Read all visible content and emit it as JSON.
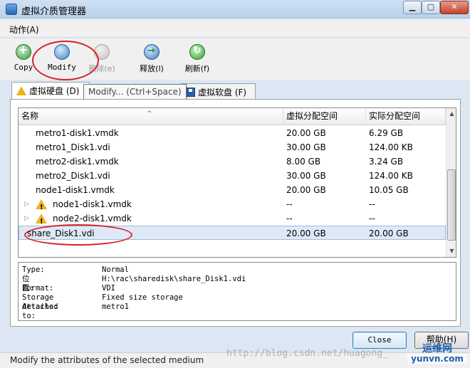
{
  "window": {
    "title": "虚拟介质管理器",
    "buttons": {
      "minimize": "▁",
      "maximize": "▢",
      "close": "✕"
    }
  },
  "menu": {
    "items": [
      {
        "label": "动作(A)"
      }
    ]
  },
  "toolbar": {
    "buttons": [
      {
        "label": "Copy",
        "icon": "copy-icon",
        "enabled": true
      },
      {
        "label": "Modify",
        "icon": "modify-icon",
        "enabled": true
      },
      {
        "label": "删除(e)",
        "icon": "delete-icon",
        "enabled": false
      },
      {
        "label": "释放(l)",
        "icon": "release-icon",
        "enabled": true
      },
      {
        "label": "刷新(f)",
        "icon": "refresh-icon",
        "enabled": true
      }
    ]
  },
  "tooltip": {
    "text": "Modify... (Ctrl+Space)"
  },
  "tabs": [
    {
      "label": "虚拟硬盘 (D)",
      "icon": "warning-icon",
      "active": true
    },
    {
      "label": "虚拟软盘 (F)",
      "icon": "floppy-icon",
      "active": false
    }
  ],
  "table": {
    "columns": {
      "name": "名称",
      "virtual_size": "虚拟分配空间",
      "actual_size": "实际分配空间"
    },
    "rows": [
      {
        "name": "metro1-disk1.vmdk",
        "virtual_size": "20.00 GB",
        "actual_size": "6.29 GB"
      },
      {
        "name": "metro1_Disk1.vdi",
        "virtual_size": "30.00 GB",
        "actual_size": "124.00 KB"
      },
      {
        "name": "metro2-disk1.vmdk",
        "virtual_size": "8.00 GB",
        "actual_size": "3.24 GB"
      },
      {
        "name": "metro2_Disk1.vdi",
        "virtual_size": "30.00 GB",
        "actual_size": "124.00 KB"
      },
      {
        "name": "node1-disk1.vmdk",
        "virtual_size": "20.00 GB",
        "actual_size": "10.05 GB"
      },
      {
        "name": "node1-disk1.vmdk",
        "virtual_size": "--",
        "actual_size": "--",
        "warning": true,
        "expandable": true
      },
      {
        "name": "node2-disk1.vmdk",
        "virtual_size": "--",
        "actual_size": "--",
        "warning": true,
        "expandable": true
      },
      {
        "name": "share_Disk1.vdi",
        "virtual_size": "20.00 GB",
        "actual_size": "20.00 GB",
        "selected": true
      }
    ]
  },
  "details": {
    "type": {
      "label": "Type:",
      "value": "Normal"
    },
    "location": {
      "label": "位置:",
      "value": "H:\\rac\\sharedisk\\share_Disk1.vdi"
    },
    "format": {
      "label": "Format:",
      "value": "VDI"
    },
    "storage": {
      "label": "Storage details:",
      "value": "Fixed size storage"
    },
    "attached": {
      "label": "Attached to:",
      "value": "metro1"
    }
  },
  "footer": {
    "close_label": "Close",
    "help_label": "帮助(H)",
    "status": "Modify the attributes of the selected medium"
  },
  "watermark": {
    "url": "http://blog.csdn.net/huagong_",
    "logo_top": "运维网",
    "logo_bottom": "yunvn.com"
  },
  "colors": {
    "annotation_red": "#d8202a",
    "selection": "#dfe9f6",
    "warning": "#f2b21a"
  }
}
